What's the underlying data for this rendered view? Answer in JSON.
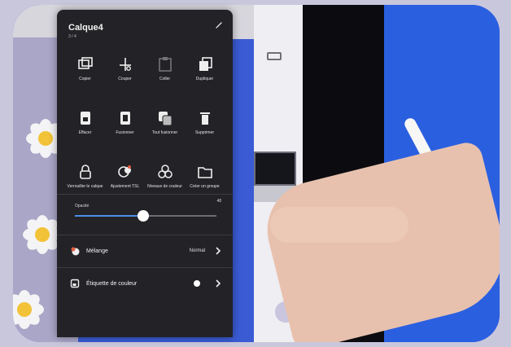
{
  "panel": {
    "title": "Calque4",
    "subtitle": "3 / 4",
    "actions": [
      {
        "label": "Copier",
        "icon": "copy-icon"
      },
      {
        "label": "Couper",
        "icon": "scissors-icon"
      },
      {
        "label": "Coller",
        "icon": "paste-icon"
      },
      {
        "label": "Dupliquer",
        "icon": "duplicate-icon"
      },
      {
        "label": "Effacer",
        "icon": "clear-layer-icon"
      },
      {
        "label": "Fusionner",
        "icon": "merge-icon"
      },
      {
        "label": "Tout fusionner",
        "icon": "merge-all-icon"
      },
      {
        "label": "Supprimer",
        "icon": "trash-icon"
      },
      {
        "label": "Verrouiller le calque",
        "icon": "lock-icon"
      },
      {
        "label": "Ajustement TSL",
        "icon": "hsl-adjust-icon"
      },
      {
        "label": "Niveaux de couleur",
        "icon": "color-levels-icon"
      },
      {
        "label": "Créer un groupe",
        "icon": "folder-icon"
      }
    ],
    "opacity": {
      "label": "Opacité",
      "value": 0.48,
      "value_text": "48"
    },
    "blend": {
      "label": "Mélange",
      "value": "Normal"
    },
    "color_tag": {
      "label": "Étiquette de couleur"
    }
  },
  "colors": {
    "panel_bg": "#232327",
    "accent": "#4b8ee8",
    "background_wall": "#2a5fe0"
  }
}
